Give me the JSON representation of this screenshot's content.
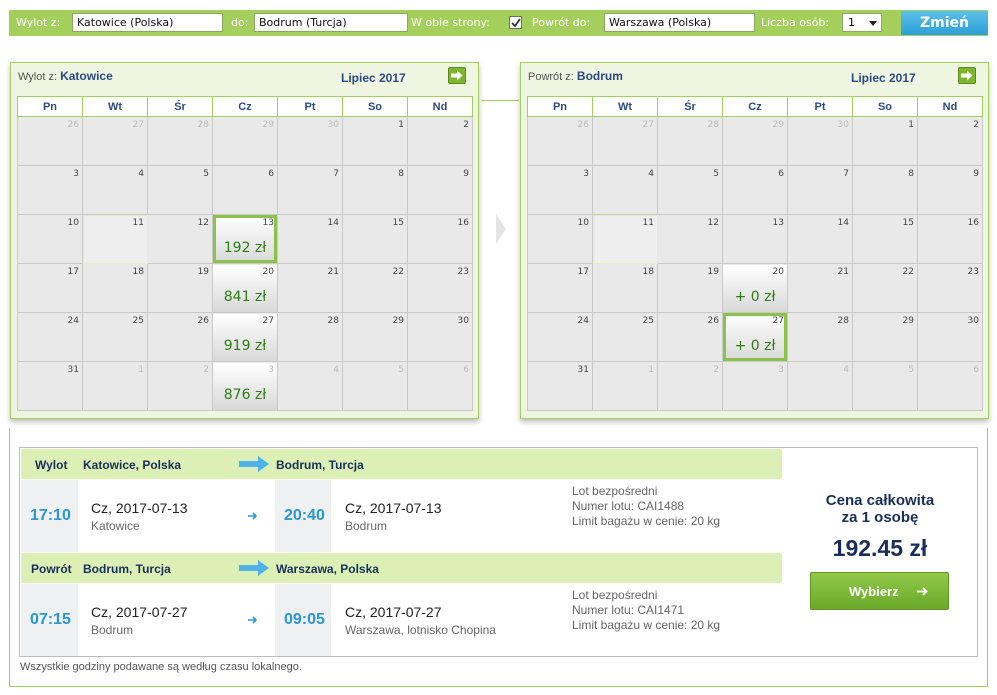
{
  "search": {
    "from_label": "Wylot z:",
    "from_value": "Katowice (Polska)",
    "to_label": "do:",
    "to_value": "Bodrum (Turcja)",
    "roundtrip_label": "W obie strony:",
    "roundtrip_checked": true,
    "return_label": "Powrót do:",
    "return_value": "Warszawa (Polska)",
    "persons_label": "Liczba osób:",
    "persons_value": "1",
    "submit_label": "Zmień"
  },
  "weekdays": [
    "Pn",
    "Wt",
    "Śr",
    "Cz",
    "Pt",
    "So",
    "Nd"
  ],
  "outbound_calendar": {
    "prefix": "Wylot z:",
    "city": "Katowice",
    "month": "Lipiec 2017",
    "weeks": [
      [
        {
          "d": "26",
          "o": true
        },
        {
          "d": "27",
          "o": true
        },
        {
          "d": "28",
          "o": true
        },
        {
          "d": "29",
          "o": true
        },
        {
          "d": "30",
          "o": true
        },
        {
          "d": "1"
        },
        {
          "d": "2"
        }
      ],
      [
        {
          "d": "3"
        },
        {
          "d": "4"
        },
        {
          "d": "5"
        },
        {
          "d": "6"
        },
        {
          "d": "7"
        },
        {
          "d": "8"
        },
        {
          "d": "9"
        }
      ],
      [
        {
          "d": "10"
        },
        {
          "d": "11",
          "t": true
        },
        {
          "d": "12"
        },
        {
          "d": "13",
          "p": "192 zł",
          "s": true
        },
        {
          "d": "14"
        },
        {
          "d": "15"
        },
        {
          "d": "16"
        }
      ],
      [
        {
          "d": "17"
        },
        {
          "d": "18"
        },
        {
          "d": "19"
        },
        {
          "d": "20",
          "p": "841 zł"
        },
        {
          "d": "21"
        },
        {
          "d": "22"
        },
        {
          "d": "23"
        }
      ],
      [
        {
          "d": "24"
        },
        {
          "d": "25"
        },
        {
          "d": "26"
        },
        {
          "d": "27",
          "p": "919 zł"
        },
        {
          "d": "28"
        },
        {
          "d": "29"
        },
        {
          "d": "30"
        }
      ],
      [
        {
          "d": "31"
        },
        {
          "d": "1",
          "o": true
        },
        {
          "d": "2",
          "o": true
        },
        {
          "d": "3",
          "o": true,
          "p": "876 zł"
        },
        {
          "d": "4",
          "o": true
        },
        {
          "d": "5",
          "o": true
        },
        {
          "d": "6",
          "o": true
        }
      ]
    ]
  },
  "return_calendar": {
    "prefix": "Powrót z:",
    "city": "Bodrum",
    "month": "Lipiec 2017",
    "weeks": [
      [
        {
          "d": "26",
          "o": true
        },
        {
          "d": "27",
          "o": true
        },
        {
          "d": "28",
          "o": true
        },
        {
          "d": "29",
          "o": true
        },
        {
          "d": "30",
          "o": true
        },
        {
          "d": "1"
        },
        {
          "d": "2"
        }
      ],
      [
        {
          "d": "3"
        },
        {
          "d": "4"
        },
        {
          "d": "5"
        },
        {
          "d": "6"
        },
        {
          "d": "7"
        },
        {
          "d": "8"
        },
        {
          "d": "9"
        }
      ],
      [
        {
          "d": "10"
        },
        {
          "d": "11",
          "t": true
        },
        {
          "d": "12"
        },
        {
          "d": "13"
        },
        {
          "d": "14"
        },
        {
          "d": "15"
        },
        {
          "d": "16"
        }
      ],
      [
        {
          "d": "17"
        },
        {
          "d": "18"
        },
        {
          "d": "19"
        },
        {
          "d": "20",
          "p": "+ 0 zł"
        },
        {
          "d": "21"
        },
        {
          "d": "22"
        },
        {
          "d": "23"
        }
      ],
      [
        {
          "d": "24"
        },
        {
          "d": "25"
        },
        {
          "d": "26"
        },
        {
          "d": "27",
          "p": "+ 0 zł",
          "s": true
        },
        {
          "d": "28"
        },
        {
          "d": "29"
        },
        {
          "d": "30"
        }
      ],
      [
        {
          "d": "31"
        },
        {
          "d": "1",
          "o": true
        },
        {
          "d": "2",
          "o": true
        },
        {
          "d": "3",
          "o": true
        },
        {
          "d": "4",
          "o": true
        },
        {
          "d": "5",
          "o": true
        },
        {
          "d": "6",
          "o": true
        }
      ]
    ]
  },
  "outbound": {
    "label": "Wylot",
    "from": "Katowice, Polska",
    "to": "Bodrum, Turcja",
    "dep_time": "17:10",
    "dep_date": "Cz, 2017-07-13",
    "dep_city": "Katowice",
    "arr_time": "20:40",
    "arr_date": "Cz, 2017-07-13",
    "arr_city": "Bodrum",
    "info1": "Lot bezpośredni",
    "info2": "Numer lotu: CAI1488",
    "info3": "Limit bagażu w cenie: 20 kg"
  },
  "return": {
    "label": "Powrót",
    "from": "Bodrum, Turcja",
    "to": "Warszawa, Polska",
    "dep_time": "07:15",
    "dep_date": "Cz, 2017-07-27",
    "dep_city": "Bodrum",
    "arr_time": "09:05",
    "arr_date": "Cz, 2017-07-27",
    "arr_city": "Warszawa, lotnisko Chopina",
    "info1": "Lot bezpośredni",
    "info2": "Numer lotu: CAI1471",
    "info3": "Limit bagażu w cenie: 20 kg"
  },
  "price": {
    "label_line1": "Cena całkowita",
    "label_line2": "za 1 osobę",
    "value": "192.45 zł",
    "select_label": "Wybierz"
  },
  "footnote": "Wszystkie godziny podawane są według czasu lokalnego.",
  "colors": {
    "accent_green": "#a4cf5c",
    "button_blue": "#2c9fd6",
    "price_green": "#2f7c15",
    "navy": "#1a2e5c",
    "time_blue": "#2a96d2"
  }
}
